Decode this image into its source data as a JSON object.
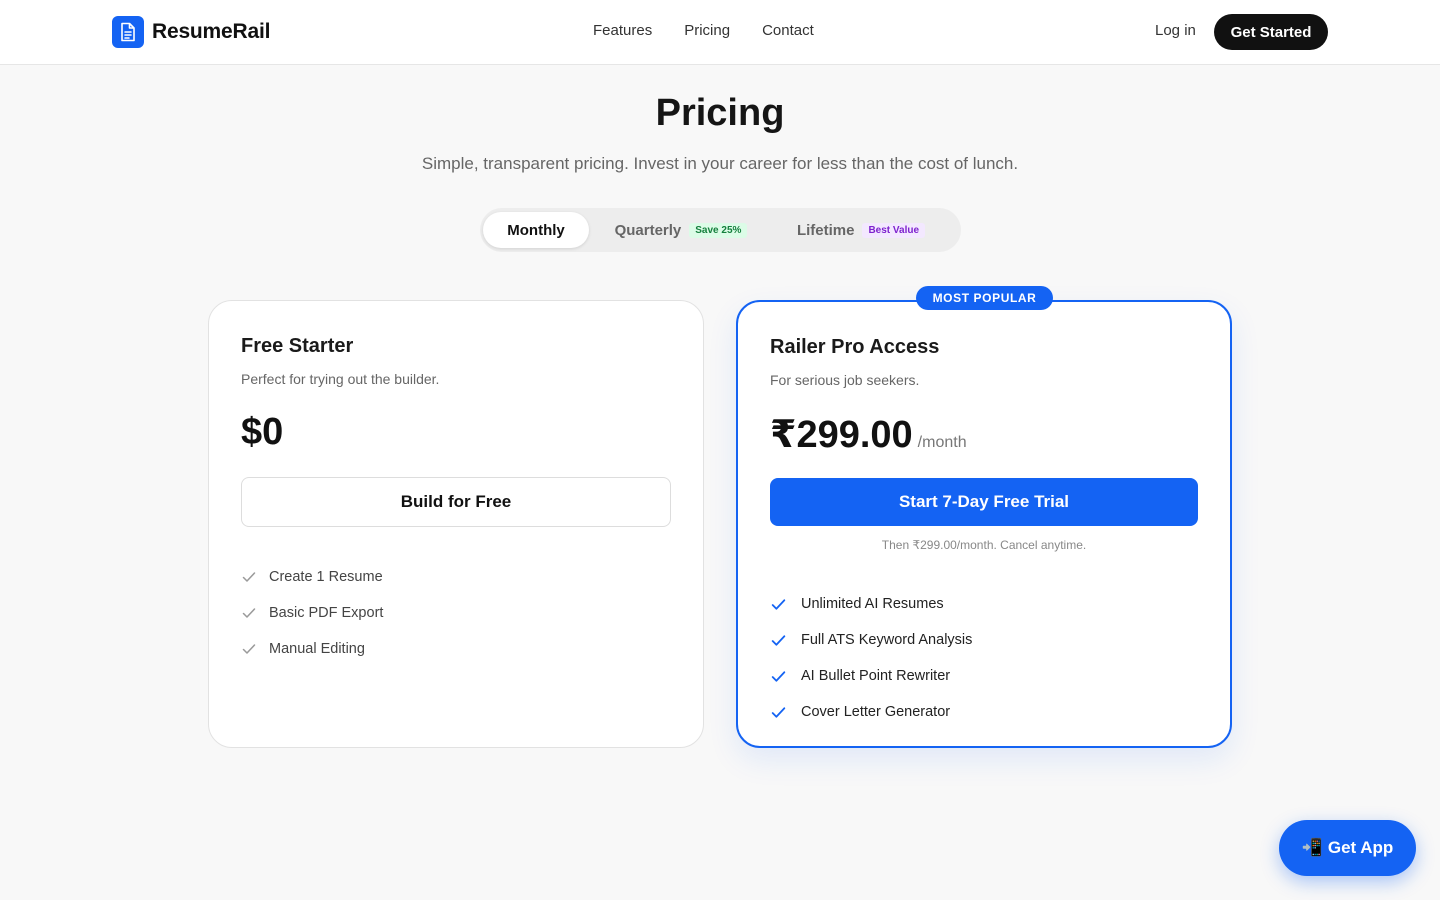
{
  "brand": {
    "name": "ResumeRail",
    "logo_icon": "document-icon",
    "accent": "#1463f3"
  },
  "nav": {
    "links": [
      "Features",
      "Pricing",
      "Contact"
    ]
  },
  "header": {
    "login_label": "Log in",
    "cta_label": "Get Started"
  },
  "hero": {
    "title": "Pricing",
    "subtitle": "Simple, transparent pricing. Invest in your career for less than the cost of lunch."
  },
  "billing": {
    "selected": "Monthly",
    "options": [
      {
        "label": "Monthly",
        "badge": ""
      },
      {
        "label": "Quarterly",
        "badge": "Save 25%"
      },
      {
        "label": "Lifetime",
        "badge": "Best Value"
      }
    ]
  },
  "plans": [
    {
      "name": "Free Starter",
      "description": "Perfect for trying out the builder.",
      "price": "$0",
      "period": "",
      "cta": "Build for Free",
      "features": [
        "Create 1 Resume",
        "Basic PDF Export",
        "Manual Editing"
      ]
    },
    {
      "badge": "MOST POPULAR",
      "name": "Railer Pro Access",
      "description": "For serious job seekers.",
      "price": "₹299.00",
      "period": "/month",
      "cta": "Start 7-Day Free Trial",
      "note": "Then ₹299.00/month. Cancel anytime.",
      "features": [
        "Unlimited AI Resumes",
        "Full ATS Keyword Analysis",
        "AI Bullet Point Rewriter",
        "Cover Letter Generator"
      ]
    }
  ],
  "floating": {
    "icon": "📲",
    "label": "Get App"
  },
  "icons": {
    "check": "check-icon"
  }
}
